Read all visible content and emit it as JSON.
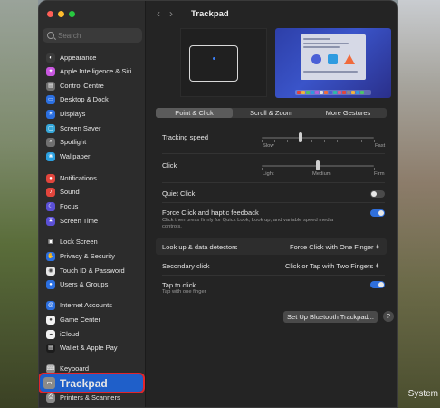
{
  "window": {
    "title": "Trackpad"
  },
  "search": {
    "placeholder": "Search"
  },
  "sidebar": {
    "items": [
      {
        "label": "Appearance",
        "color": "#3a3a3a",
        "glyph": "◐"
      },
      {
        "label": "Apple Intelligence & Siri",
        "color": "#c957e0",
        "glyph": "✦"
      },
      {
        "label": "Control Centre",
        "color": "#707070",
        "glyph": "▤"
      },
      {
        "label": "Desktop & Dock",
        "color": "#2b6fe0",
        "glyph": "▭"
      },
      {
        "label": "Displays",
        "color": "#2b6fe0",
        "glyph": "☀"
      },
      {
        "label": "Screen Saver",
        "color": "#35a6d8",
        "glyph": "▢"
      },
      {
        "label": "Spotlight",
        "color": "#707070",
        "glyph": "⌕"
      },
      {
        "label": "Wallpaper",
        "color": "#2ba0e0",
        "glyph": "❀"
      },
      {
        "label": "Notifications",
        "color": "#e2453c",
        "glyph": "●"
      },
      {
        "label": "Sound",
        "color": "#e2453c",
        "glyph": "♪"
      },
      {
        "label": "Focus",
        "color": "#5b50d6",
        "glyph": "☾"
      },
      {
        "label": "Screen Time",
        "color": "#5b50d6",
        "glyph": "⧗"
      },
      {
        "label": "Lock Screen",
        "color": "#2a2a2a",
        "glyph": "▣"
      },
      {
        "label": "Privacy & Security",
        "color": "#2b6fe0",
        "glyph": "✋"
      },
      {
        "label": "Touch ID & Password",
        "color": "#e8e8e8",
        "glyph": "◉"
      },
      {
        "label": "Users & Groups",
        "color": "#2b6fe0",
        "glyph": "●"
      },
      {
        "label": "Internet Accounts",
        "color": "#2b6fe0",
        "glyph": "@"
      },
      {
        "label": "Game Center",
        "color": "#f2f2f2",
        "glyph": "●"
      },
      {
        "label": "iCloud",
        "color": "#f2f2f2",
        "glyph": "☁"
      },
      {
        "label": "Wallet & Apple Pay",
        "color": "#1c1c1c",
        "glyph": "▤"
      },
      {
        "label": "Keyboard",
        "color": "#8a8a8a",
        "glyph": "⌨"
      },
      {
        "label": "Trackpad",
        "color": "#8a8a8a",
        "glyph": "▭"
      },
      {
        "label": "Printers & Scanners",
        "color": "#8a8a8a",
        "glyph": "⎙"
      }
    ]
  },
  "tabs": [
    {
      "label": "Point & Click",
      "active": true
    },
    {
      "label": "Scroll & Zoom",
      "active": false
    },
    {
      "label": "More Gestures",
      "active": false
    }
  ],
  "settings": {
    "tracking_speed": {
      "label": "Tracking speed",
      "min_label": "Slow",
      "max_label": "Fast",
      "value": 0.35
    },
    "click": {
      "label": "Click",
      "left_label": "Light",
      "middle_label": "Medium",
      "right_label": "Firm",
      "value": 0.5
    },
    "quiet_click": {
      "label": "Quiet Click",
      "enabled": false
    },
    "force_click": {
      "label": "Force Click and haptic feedback",
      "description": "Click then press firmly for Quick Look, Look up, and variable speed media controls.",
      "enabled": true
    },
    "look_up": {
      "label": "Look up & data detectors",
      "value": "Force Click with One Finger"
    },
    "secondary_click": {
      "label": "Secondary click",
      "value": "Click or Tap with Two Fingers"
    },
    "tap_to_click": {
      "label": "Tap to click",
      "description": "Tap with one finger",
      "enabled": true
    }
  },
  "buttons": {
    "bluetooth": "Set Up Bluetooth Trackpad...",
    "help": "?"
  },
  "desktop": {
    "label": "System"
  }
}
